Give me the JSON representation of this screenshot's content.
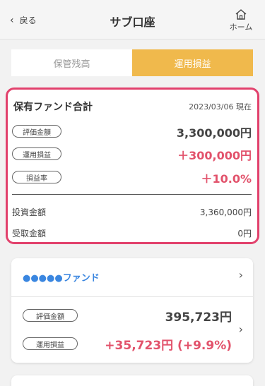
{
  "header": {
    "back_label": "戻る",
    "title": "サブ口座",
    "home_label": "ホーム"
  },
  "tabs": [
    {
      "label": "保管残高",
      "active": false
    },
    {
      "label": "運用損益",
      "active": true
    }
  ],
  "summary": {
    "heading": "保有ファンド合計",
    "date": "2023/03/06 現在",
    "rows": [
      {
        "label": "評価金額",
        "value": "3,300,000円"
      },
      {
        "label": "運用損益",
        "value": "＋300,000円"
      },
      {
        "label": "損益率",
        "value": "＋10.0%"
      }
    ],
    "lines": [
      {
        "label": "投資金額",
        "value": "3,360,000円"
      },
      {
        "label": "受取金額",
        "value": "0円"
      }
    ]
  },
  "fund": {
    "name": "●●●●●ファンド",
    "eval_label": "評価金額",
    "eval_value": "395,723円",
    "pl_label": "運用損益",
    "pl_value": "+35,723円 (+9.9%)"
  },
  "colors": {
    "accent": "#f0b94c",
    "highlight": "#e2416c",
    "profit": "#e2526b",
    "fund_name": "#3a86e0"
  }
}
